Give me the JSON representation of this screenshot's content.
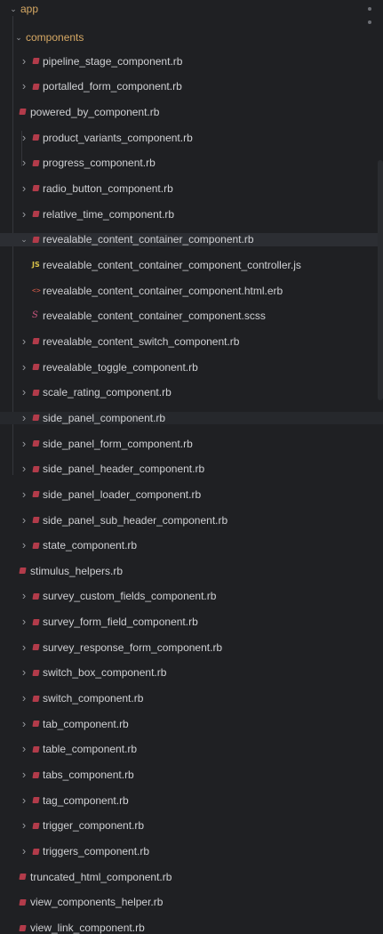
{
  "explorer": {
    "root": {
      "label": "app"
    },
    "components": {
      "label": "components"
    },
    "items": [
      {
        "label": "pipeline_stage_component.rb"
      },
      {
        "label": "portalled_form_component.rb"
      },
      {
        "label": "powered_by_component.rb"
      },
      {
        "label": "product_variants_component.rb"
      },
      {
        "label": "progress_component.rb"
      },
      {
        "label": "radio_button_component.rb"
      },
      {
        "label": "relative_time_component.rb"
      },
      {
        "label": "revealable_content_container_component.rb"
      },
      {
        "label": "revealable_content_container_component_controller.js"
      },
      {
        "label": "revealable_content_container_component.html.erb"
      },
      {
        "label": "revealable_content_container_component.scss"
      },
      {
        "label": "revealable_content_switch_component.rb"
      },
      {
        "label": "revealable_toggle_component.rb"
      },
      {
        "label": "scale_rating_component.rb"
      },
      {
        "label": "side_panel_component.rb"
      },
      {
        "label": "side_panel_form_component.rb"
      },
      {
        "label": "side_panel_header_component.rb"
      },
      {
        "label": "side_panel_loader_component.rb"
      },
      {
        "label": "side_panel_sub_header_component.rb"
      },
      {
        "label": "state_component.rb"
      },
      {
        "label": "stimulus_helpers.rb"
      },
      {
        "label": "survey_custom_fields_component.rb"
      },
      {
        "label": "survey_form_field_component.rb"
      },
      {
        "label": "survey_response_form_component.rb"
      },
      {
        "label": "switch_box_component.rb"
      },
      {
        "label": "switch_component.rb"
      },
      {
        "label": "tab_component.rb"
      },
      {
        "label": "table_component.rb"
      },
      {
        "label": "tabs_component.rb"
      },
      {
        "label": "tag_component.rb"
      },
      {
        "label": "trigger_component.rb"
      },
      {
        "label": "triggers_component.rb"
      },
      {
        "label": "truncated_html_component.rb"
      },
      {
        "label": "view_components_helper.rb"
      },
      {
        "label": "view_link_component.rb"
      }
    ]
  },
  "icons": {
    "js": "JS",
    "erb": "<>",
    "scss": "S"
  },
  "colors": {
    "background": "#1f2023",
    "folder": "#d6a864",
    "ruby": "#b23b4a",
    "selected": "#2c2e33"
  }
}
